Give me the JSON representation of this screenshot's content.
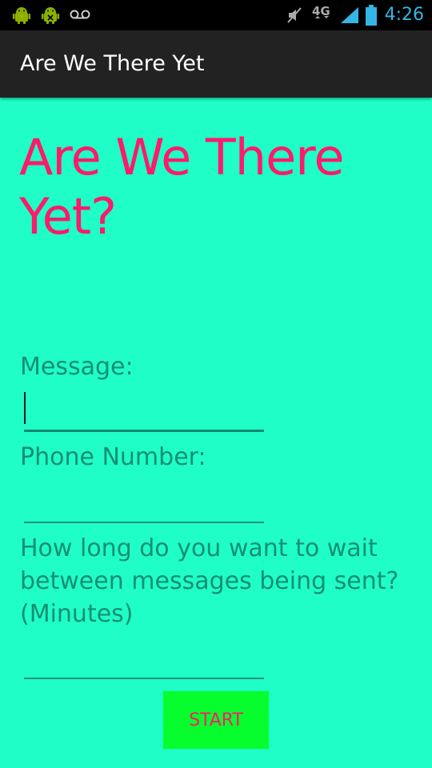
{
  "status_bar": {
    "time": "4:26",
    "network": "4G",
    "time_color": "#33b5e5",
    "icons": [
      "android-debug-icon",
      "android-debug-icon",
      "voicemail-icon",
      "mute-icon",
      "network-4g-icon",
      "signal-icon",
      "battery-icon"
    ]
  },
  "action_bar": {
    "title": "Are We There Yet"
  },
  "main": {
    "headline": "Are We There Yet?",
    "message_label": "Message:",
    "message_value": "",
    "phone_label": "Phone Number:",
    "phone_value": "",
    "wait_label": "How long do you want to wait between messages being sent? (Minutes)",
    "wait_value": "",
    "start_label": "START"
  },
  "colors": {
    "background": "#1ffec6",
    "headline": "#ff1a6a",
    "label": "#168f74",
    "button": "#06ff2c",
    "button_text": "#ff1a6a",
    "action_bar": "#222222"
  }
}
